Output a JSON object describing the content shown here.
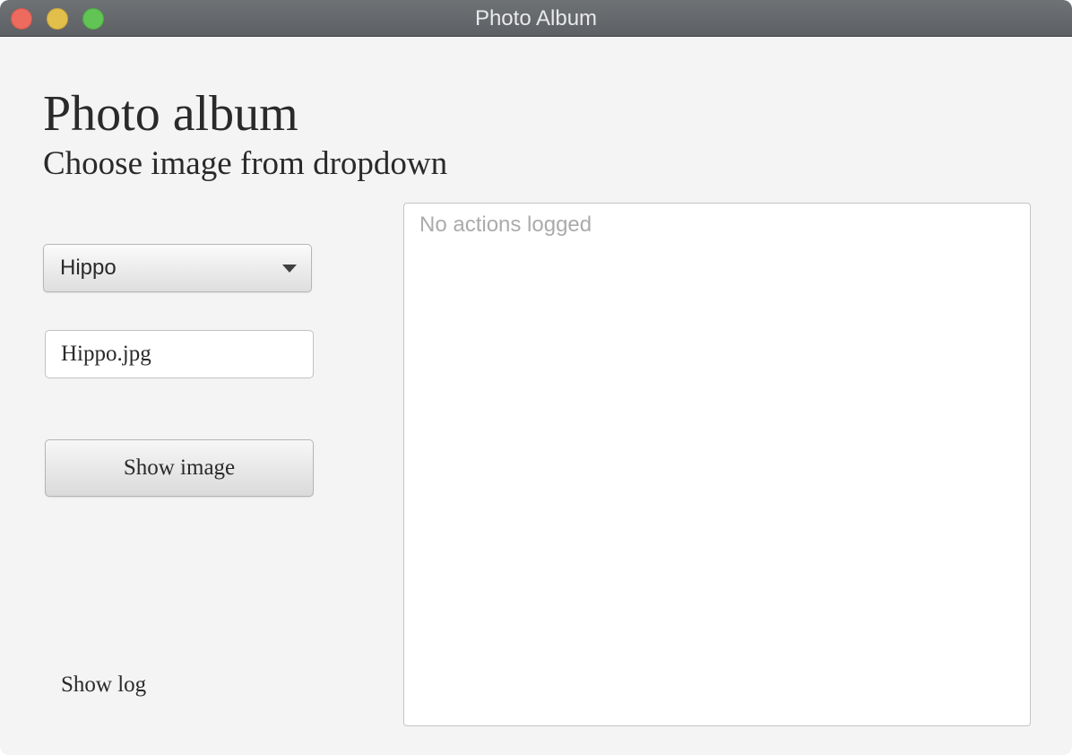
{
  "window": {
    "title": "Photo Album"
  },
  "header": {
    "title": "Photo album",
    "subtitle": "Choose image from dropdown"
  },
  "image_select": {
    "selected": "Hippo"
  },
  "filename_field": {
    "value": "Hippo.jpg"
  },
  "show_image_button": {
    "label": "Show image"
  },
  "show_log_link": {
    "label": "Show log"
  },
  "log": {
    "placeholder": "No actions logged",
    "value": ""
  },
  "colors": {
    "titlebar": "#666a6e",
    "window_background": "#f4f4f4",
    "close": "#ec6a5e",
    "minimize": "#e2be4a",
    "maximize": "#61c454"
  }
}
